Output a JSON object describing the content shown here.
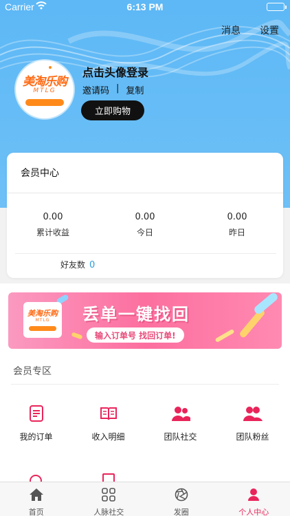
{
  "status_bar": {
    "carrier": "Carrier",
    "time": "6:13 PM"
  },
  "top_nav": {
    "message": "消息",
    "settings": "设置"
  },
  "profile": {
    "logo_cn": "美淘乐购",
    "logo_en": "MTLG",
    "login_prompt": "点击头像登录",
    "invite_code_label": "邀请码",
    "separator": "|",
    "copy_label": "复制",
    "buy_button": "立即购物"
  },
  "member_center": {
    "title": "会员中心",
    "stats": [
      {
        "value": "0.00",
        "label": "累计收益"
      },
      {
        "value": "0.00",
        "label": "今日"
      },
      {
        "value": "0.00",
        "label": "昨日"
      }
    ],
    "friends_label": "好友数",
    "friends_count": "0"
  },
  "banner": {
    "logo_cn": "美淘乐购",
    "logo_en": "MTLG",
    "title": "丢单一键找回",
    "subtitle": "输入订单号 找回订单!"
  },
  "member_zone": {
    "title": "会员专区",
    "items": [
      {
        "label": "我的订单",
        "icon": "order-icon"
      },
      {
        "label": "收入明细",
        "icon": "income-detail-icon"
      },
      {
        "label": "团队社交",
        "icon": "team-social-icon"
      },
      {
        "label": "团队粉丝",
        "icon": "team-fans-icon"
      }
    ]
  },
  "tab_bar": {
    "active_color": "#e9245a",
    "tabs": [
      {
        "label": "首页",
        "icon": "home-icon"
      },
      {
        "label": "人脉社交",
        "icon": "grid-icon"
      },
      {
        "label": "发圈",
        "icon": "aperture-icon"
      },
      {
        "label": "个人中心",
        "icon": "person-icon"
      }
    ]
  },
  "colors": {
    "header_blue": "#6ec0f7",
    "accent_pink": "#e9245a",
    "logo_orange": "#ff6a13"
  }
}
